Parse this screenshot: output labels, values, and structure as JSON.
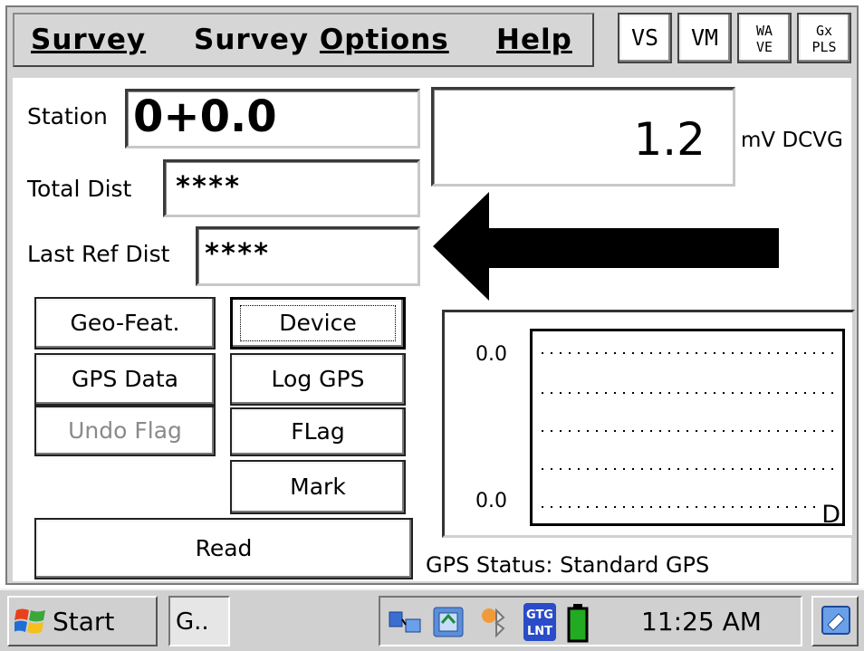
{
  "menu": {
    "survey": "Survey",
    "survey_options_1": "Survey",
    "survey_options_2": "Options",
    "help": "Help"
  },
  "toolbar": {
    "vs": "VS",
    "vm": "VM",
    "wave_1": "WA",
    "wave_2": "VE",
    "gxpls_1": "Gx",
    "gxpls_2": "PLS"
  },
  "fields": {
    "station_label": "Station",
    "station_value": "0+0.0",
    "total_dist_label": "Total Dist",
    "total_dist_value": "****",
    "last_ref_label": "Last Ref Dist",
    "last_ref_value": "****"
  },
  "reading": {
    "value": "1.2",
    "unit": "mV DCVG"
  },
  "buttons": {
    "geo_feat": "Geo-Feat.",
    "device": "Device",
    "gps_data": "GPS Data",
    "log_gps": "Log GPS",
    "undo_flag": "Undo Flag",
    "flag": "FLag",
    "mark": "Mark",
    "read": "Read"
  },
  "chart_data": {
    "type": "line",
    "y_top_label": "0.0",
    "y_bottom_label": "0.0",
    "corner_label": "D",
    "grid": true
  },
  "gps_status": "GPS Status: Standard GPS",
  "taskbar": {
    "start": "Start",
    "task_item": "G..",
    "clock": "11:25 AM",
    "gps_tray_1": "GTG",
    "gps_tray_2": "LNT"
  },
  "colors": {
    "panel_bg": "#ffffff",
    "chrome": "#d4d4d4",
    "arrow": "#000000",
    "battery": "#22aa22"
  }
}
